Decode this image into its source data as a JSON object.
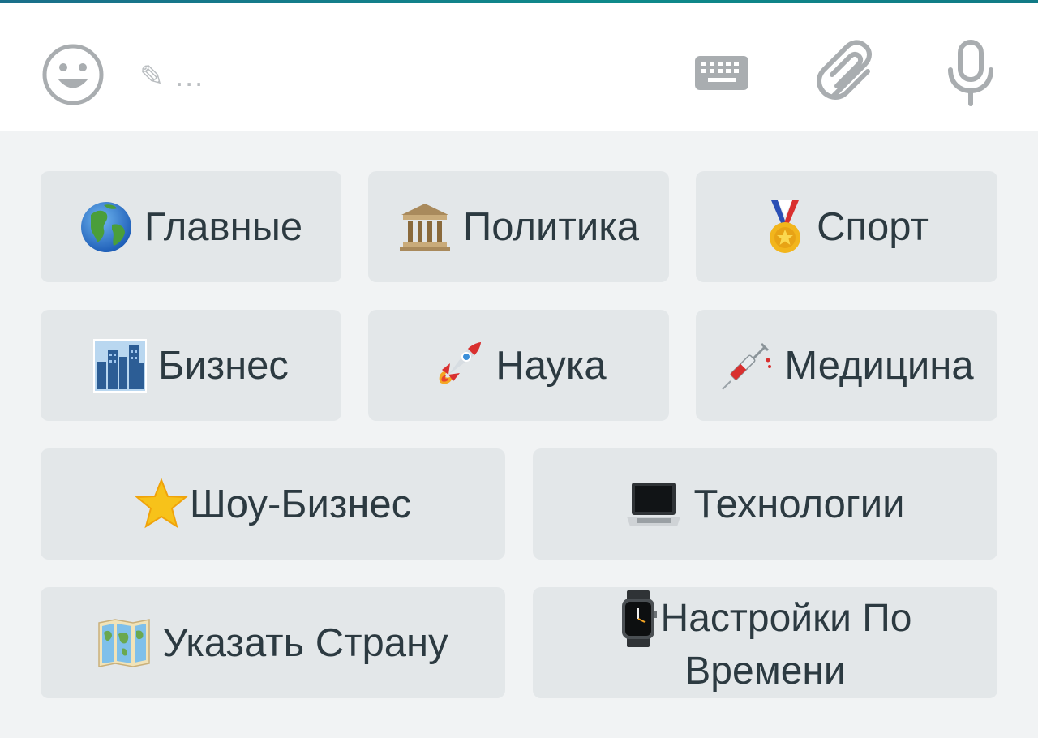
{
  "input": {
    "placeholder": "✎ ...",
    "icons": [
      "smile-icon",
      "pencil-icon",
      "keyboard-icon",
      "paperclip-icon",
      "microphone-icon"
    ]
  },
  "colors": {
    "accent": "#0e8a8a",
    "button_bg": "#e3e7e9",
    "button_text": "#2c3a41",
    "icon_gray": "#a9adb0"
  },
  "buttons": {
    "main": {
      "label": "Главные",
      "icon": "globe-icon"
    },
    "politics": {
      "label": "Политика",
      "icon": "classical-building-icon"
    },
    "sport": {
      "label": "Спорт",
      "icon": "medal-icon"
    },
    "business": {
      "label": "Бизнес",
      "icon": "city-icon"
    },
    "science": {
      "label": "Наука",
      "icon": "rocket-icon"
    },
    "medicine": {
      "label": "Медицина",
      "icon": "syringe-icon"
    },
    "showbiz": {
      "label": "Шоу-Бизнес",
      "icon": "star-icon"
    },
    "tech": {
      "label": "Технологии",
      "icon": "laptop-icon"
    },
    "country": {
      "label": "Указать Страну",
      "icon": "world-map-icon"
    },
    "time_settings": {
      "label_line1": "Настройки По",
      "label_line2": "Времени",
      "icon": "watch-icon"
    }
  }
}
